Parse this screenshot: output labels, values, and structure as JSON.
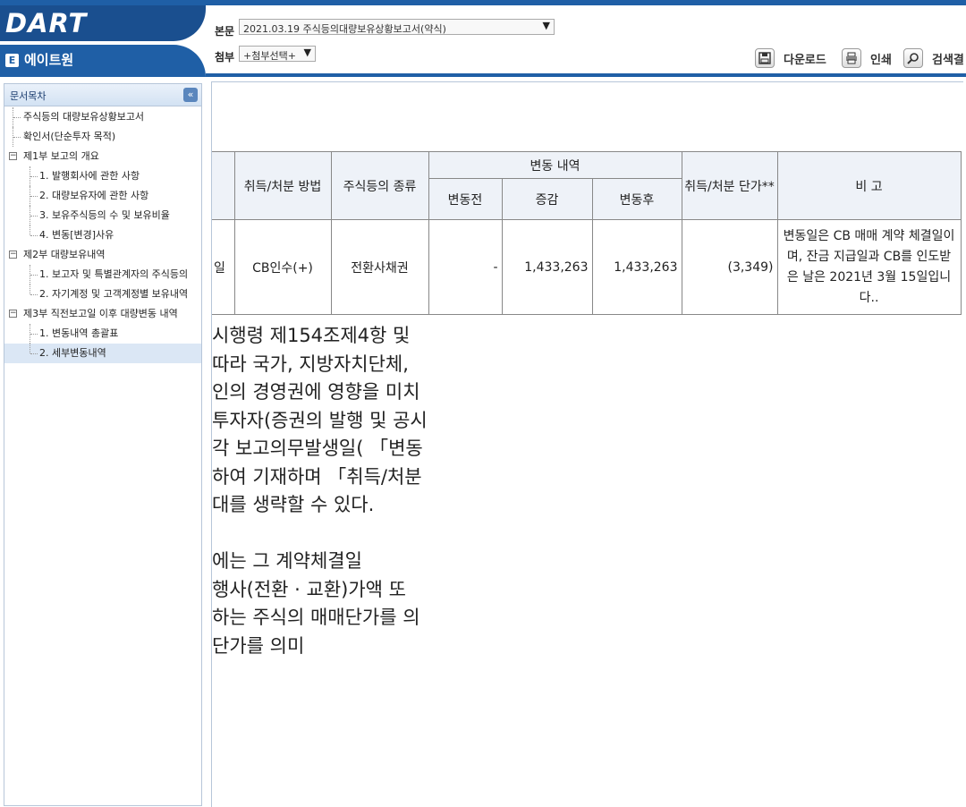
{
  "app": {
    "logo": "DART",
    "brand_sub": "에이트원",
    "brand_icon": "E"
  },
  "header": {
    "main_label": "본문",
    "main_select": "2021.03.19  주식등의대량보유상황보고서(약식)",
    "attach_label": "첨부",
    "attach_select": "+첨부선택+",
    "download_label": "다운로드",
    "print_label": "인쇄",
    "search_label": "검색결"
  },
  "sidebar": {
    "title": "문서목차",
    "items": [
      {
        "label": "주식등의 대량보유상황보고서"
      },
      {
        "label": "확인서(단순투자 목적)"
      },
      {
        "label": "제1부 보고의 개요",
        "toggle": "−"
      },
      {
        "label": "1. 발행회사에 관한 사항"
      },
      {
        "label": "2. 대량보유자에 관한 사항"
      },
      {
        "label": "3. 보유주식등의 수 및 보유비율"
      },
      {
        "label": "4. 변동[변경]사유"
      },
      {
        "label": "제2부 대량보유내역",
        "toggle": "−"
      },
      {
        "label": "1. 보고자 및 특별관계자의 주식등의"
      },
      {
        "label": "2. 자기계정 및 고객계정별 보유내역"
      },
      {
        "label": "제3부 직전보고일 이후 대량변동 내역",
        "toggle": "−"
      },
      {
        "label": "1. 변동내역 총괄표"
      },
      {
        "label": "2. 세부변동내역"
      }
    ]
  },
  "table": {
    "headers": {
      "method": "취득/처분 방법",
      "kind": "주식등의 종류",
      "change_group": "변동 내역",
      "before": "변동전",
      "delta": "증감",
      "after": "변동후",
      "price": "취득/처분 단가**",
      "note": "비 고"
    },
    "row": {
      "date_fragment": "일",
      "method": "CB인수(+)",
      "kind": "전환사채권",
      "before": "-",
      "delta": "1,433,263",
      "after": "1,433,263",
      "price": "(3,349)",
      "note": "변동일은 CB 매매 계약 체결일이며, 잔금 지급일과 CB를 인도받은 날은 2021년 3월 15일입니다.."
    }
  },
  "body_text": [
    " 시행령 제154조제4항 및",
    " 따라  국가,  지방자치단체,",
    "인의 경영권에 영향을 미치",
    "투자자(증권의 발행 및 공시",
    "각  보고의무발생일( 「변동",
    "하여  기재하며  「취득/처분",
    "대를 생략할 수 있다.",
    "",
    "에는 그 계약체결일",
    " 행사(전환 · 교환)가액 또",
    "하는 주식의 매매단가를 의",
    "단가를 의미"
  ]
}
